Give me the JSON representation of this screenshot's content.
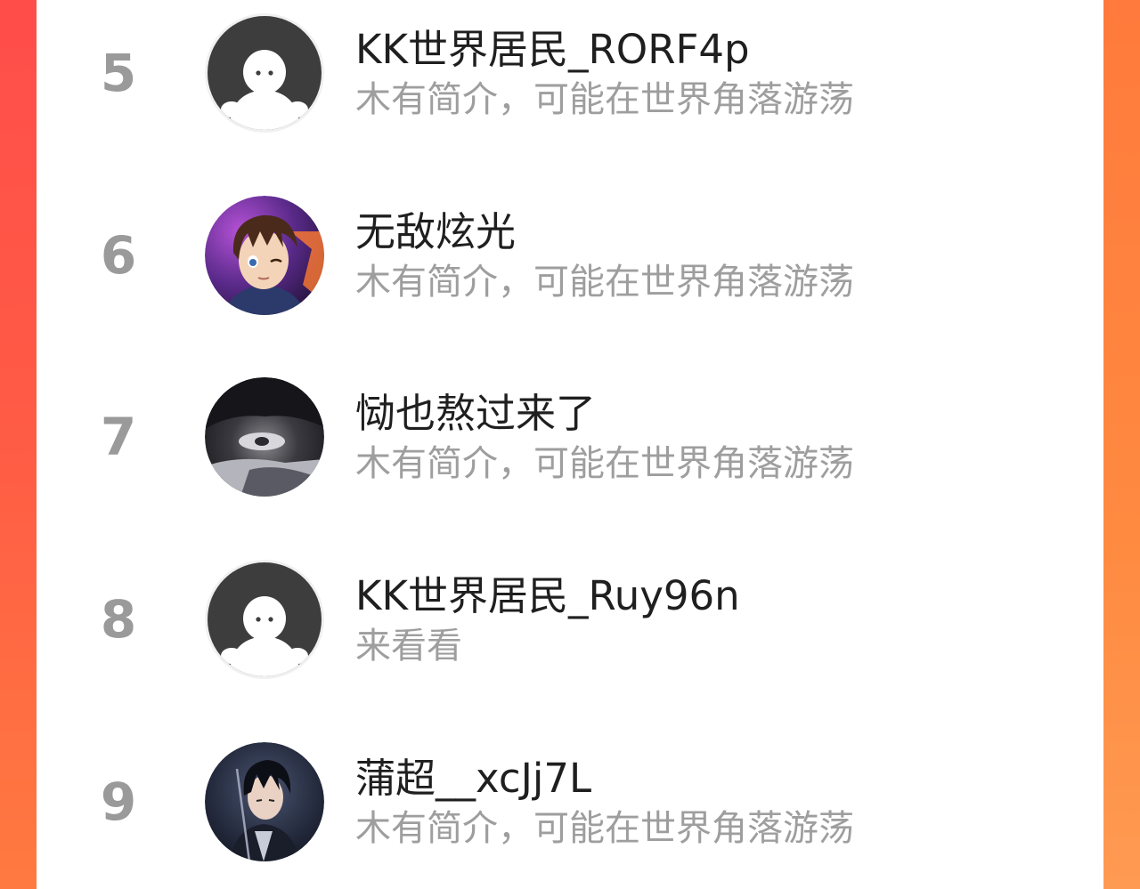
{
  "ranking": {
    "rows": [
      {
        "rank": "5",
        "name": "KK世界居民_RORF4p",
        "bio": "木有简介，可能在世界角落游荡",
        "avatar_type": "default-ghost"
      },
      {
        "rank": "6",
        "name": "无敌炫光",
        "bio": "木有简介，可能在世界角落游荡",
        "avatar_type": "anime-boy"
      },
      {
        "rank": "7",
        "name": "恸也熬过来了",
        "bio": "木有简介，可能在世界角落游荡",
        "avatar_type": "dark-portrait"
      },
      {
        "rank": "8",
        "name": "KK世界居民_Ruy96n",
        "bio": "来看看",
        "avatar_type": "default-ghost"
      },
      {
        "rank": "9",
        "name": "蒲超__xcJj7L",
        "bio": "木有简介，可能在世界角落游荡",
        "avatar_type": "anime-swordsman"
      }
    ]
  },
  "colors": {
    "background_left": "#ff4d4a",
    "background_right": "#ff8a40",
    "card": "#ffffff",
    "rank_text": "#9a9a9a",
    "name_text": "#1f1f1f",
    "bio_text": "#9e9e9e"
  }
}
